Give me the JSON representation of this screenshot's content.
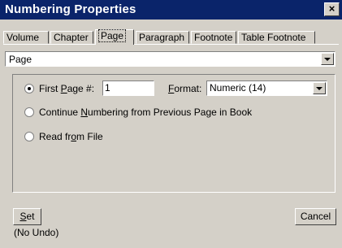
{
  "window": {
    "title": "Numbering Properties",
    "close_glyph": "×"
  },
  "tabs": [
    {
      "label": "Volume",
      "active": false
    },
    {
      "label": "Chapter",
      "active": false
    },
    {
      "label": "Page",
      "active": true
    },
    {
      "label": "Paragraph",
      "active": false
    },
    {
      "label": "Footnote",
      "active": false
    },
    {
      "label": "Table Footnote",
      "active": false
    }
  ],
  "type_dropdown": {
    "value": "Page"
  },
  "options": {
    "first_page": {
      "pre": "First ",
      "key": "P",
      "post": "age #:",
      "checked": true,
      "value": "1"
    },
    "format": {
      "key": "F",
      "post": "ormat:",
      "value": "Numeric  (14)"
    },
    "continue": {
      "pre": "Continue ",
      "key": "N",
      "post": "umbering from Previous Page in Book",
      "checked": false
    },
    "read_from_file": {
      "pre": "Read fr",
      "key": "o",
      "post": "m File",
      "checked": false
    }
  },
  "buttons": {
    "set_key": "S",
    "set_rest": "et",
    "cancel": "Cancel"
  },
  "status": {
    "undo_note": "(No Undo)"
  }
}
